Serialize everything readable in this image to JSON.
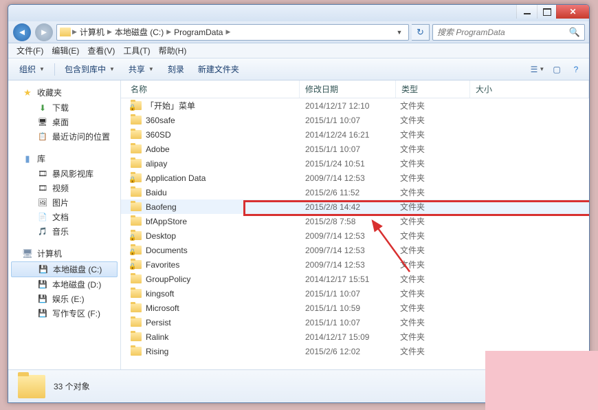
{
  "breadcrumb": {
    "root_icon": "folder",
    "items": [
      "计算机",
      "本地磁盘 (C:)",
      "ProgramData"
    ]
  },
  "search": {
    "placeholder": "搜索 ProgramData"
  },
  "menubar": [
    "文件(F)",
    "编辑(E)",
    "查看(V)",
    "工具(T)",
    "帮助(H)"
  ],
  "toolbar": {
    "organize": "组织",
    "include": "包含到库中",
    "share": "共享",
    "burn": "刻录",
    "newfolder": "新建文件夹"
  },
  "sidebar": {
    "favorites": {
      "label": "收藏夹",
      "items": [
        {
          "icon": "dl",
          "label": "下载"
        },
        {
          "icon": "desk",
          "label": "桌面"
        },
        {
          "icon": "recent",
          "label": "最近访问的位置"
        }
      ]
    },
    "libraries": {
      "label": "库",
      "items": [
        {
          "icon": "vid",
          "label": "暴风影视库"
        },
        {
          "icon": "vid",
          "label": "视频"
        },
        {
          "icon": "pic",
          "label": "图片"
        },
        {
          "icon": "doc",
          "label": "文档"
        },
        {
          "icon": "mus",
          "label": "音乐"
        }
      ]
    },
    "computer": {
      "label": "计算机",
      "items": [
        {
          "icon": "drv",
          "label": "本地磁盘 (C:)",
          "selected": true
        },
        {
          "icon": "drv",
          "label": "本地磁盘 (D:)"
        },
        {
          "icon": "drv",
          "label": "娱乐 (E:)"
        },
        {
          "icon": "drv",
          "label": "写作专区 (F:)"
        }
      ]
    }
  },
  "columns": {
    "name": "名称",
    "date": "修改日期",
    "type": "类型",
    "size": "大小"
  },
  "files": [
    {
      "name": "「开始」菜单",
      "date": "2014/12/17 12:10",
      "type": "文件夹",
      "locked": true
    },
    {
      "name": "360safe",
      "date": "2015/1/1 10:07",
      "type": "文件夹",
      "locked": false
    },
    {
      "name": "360SD",
      "date": "2014/12/24 16:21",
      "type": "文件夹",
      "locked": false
    },
    {
      "name": "Adobe",
      "date": "2015/1/1 10:07",
      "type": "文件夹",
      "locked": false
    },
    {
      "name": "alipay",
      "date": "2015/1/24 10:51",
      "type": "文件夹",
      "locked": false
    },
    {
      "name": "Application Data",
      "date": "2009/7/14 12:53",
      "type": "文件夹",
      "locked": true
    },
    {
      "name": "Baidu",
      "date": "2015/2/6 11:52",
      "type": "文件夹",
      "locked": false
    },
    {
      "name": "Baofeng",
      "date": "2015/2/8 14:42",
      "type": "文件夹",
      "locked": false,
      "highlighted": true
    },
    {
      "name": "bfAppStore",
      "date": "2015/2/8 7:58",
      "type": "文件夹",
      "locked": false
    },
    {
      "name": "Desktop",
      "date": "2009/7/14 12:53",
      "type": "文件夹",
      "locked": true
    },
    {
      "name": "Documents",
      "date": "2009/7/14 12:53",
      "type": "文件夹",
      "locked": true
    },
    {
      "name": "Favorites",
      "date": "2009/7/14 12:53",
      "type": "文件夹",
      "locked": true
    },
    {
      "name": "GroupPolicy",
      "date": "2014/12/17 15:51",
      "type": "文件夹",
      "locked": false
    },
    {
      "name": "kingsoft",
      "date": "2015/1/1 10:07",
      "type": "文件夹",
      "locked": false
    },
    {
      "name": "Microsoft",
      "date": "2015/1/1 10:59",
      "type": "文件夹",
      "locked": false
    },
    {
      "name": "Persist",
      "date": "2015/1/1 10:07",
      "type": "文件夹",
      "locked": false
    },
    {
      "name": "Ralink",
      "date": "2014/12/17 15:09",
      "type": "文件夹",
      "locked": false
    },
    {
      "name": "Rising",
      "date": "2015/2/6 12:02",
      "type": "文件夹",
      "locked": false
    }
  ],
  "status": {
    "count_label": "33 个对象"
  }
}
